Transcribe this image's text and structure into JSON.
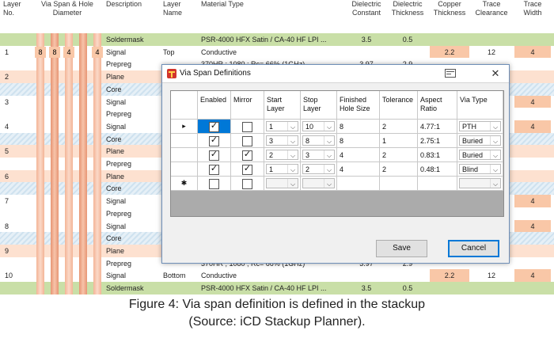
{
  "stackup": {
    "columns": [
      "Layer No.",
      "Via Span & Hole Diameter",
      "Description",
      "Layer Name",
      "Material Type",
      "Dielectric Constant",
      "Dielectric Thickness",
      "Copper Thickness",
      "Trace Clearance",
      "Trace Width"
    ],
    "via_header_values": [
      "8",
      "8",
      "4",
      "4"
    ],
    "rows": [
      {
        "no": "",
        "desc": "Soldermask",
        "name": "",
        "material": "PSR-4000 HFX Satin / CA-40 HF LPI ...",
        "dk": "3.5",
        "dt": "0.5",
        "cu": "",
        "clr": "",
        "w": "",
        "bg": "green"
      },
      {
        "no": "1",
        "desc": "Signal",
        "name": "Top",
        "material": "Conductive",
        "dk": "",
        "dt": "",
        "cu": "2.2",
        "clr": "12",
        "w": "4",
        "bg": "white"
      },
      {
        "no": "",
        "desc": "Prepreg",
        "name": "",
        "material": "370HR ; 1080 ; Rc= 66% (1GHz)",
        "dk": "3.97",
        "dt": "2.9",
        "cu": "",
        "clr": "",
        "w": "",
        "bg": "white"
      },
      {
        "no": "2",
        "desc": "Plane",
        "name": "",
        "material": "",
        "dk": "",
        "dt": "",
        "cu": "",
        "clr": "",
        "w": "",
        "bg": "peach"
      },
      {
        "no": "",
        "desc": "Core",
        "name": "",
        "material": "",
        "dk": "",
        "dt": "",
        "cu": "",
        "clr": "",
        "w": "",
        "bg": "hatch"
      },
      {
        "no": "3",
        "desc": "Signal",
        "name": "",
        "material": "",
        "dk": "",
        "dt": "",
        "cu": "",
        "clr": "",
        "w": "4",
        "bg": "white"
      },
      {
        "no": "",
        "desc": "Prepreg",
        "name": "",
        "material": "",
        "dk": "",
        "dt": "",
        "cu": "",
        "clr": "",
        "w": "",
        "bg": "white"
      },
      {
        "no": "4",
        "desc": "Signal",
        "name": "",
        "material": "",
        "dk": "",
        "dt": "",
        "cu": "",
        "clr": "",
        "w": "4",
        "bg": "white"
      },
      {
        "no": "",
        "desc": "Core",
        "name": "",
        "material": "",
        "dk": "",
        "dt": "",
        "cu": "",
        "clr": "",
        "w": "",
        "bg": "hatch"
      },
      {
        "no": "5",
        "desc": "Plane",
        "name": "",
        "material": "",
        "dk": "",
        "dt": "",
        "cu": "",
        "clr": "",
        "w": "",
        "bg": "peach"
      },
      {
        "no": "",
        "desc": "Prepreg",
        "name": "",
        "material": "",
        "dk": "",
        "dt": "",
        "cu": "",
        "clr": "",
        "w": "",
        "bg": "white"
      },
      {
        "no": "6",
        "desc": "Plane",
        "name": "",
        "material": "",
        "dk": "",
        "dt": "",
        "cu": "",
        "clr": "",
        "w": "",
        "bg": "peach"
      },
      {
        "no": "",
        "desc": "Core",
        "name": "",
        "material": "",
        "dk": "",
        "dt": "",
        "cu": "",
        "clr": "",
        "w": "",
        "bg": "hatch"
      },
      {
        "no": "7",
        "desc": "Signal",
        "name": "",
        "material": "",
        "dk": "",
        "dt": "",
        "cu": "",
        "clr": "",
        "w": "4",
        "bg": "white"
      },
      {
        "no": "",
        "desc": "Prepreg",
        "name": "",
        "material": "",
        "dk": "",
        "dt": "",
        "cu": "",
        "clr": "",
        "w": "",
        "bg": "white"
      },
      {
        "no": "8",
        "desc": "Signal",
        "name": "",
        "material": "",
        "dk": "",
        "dt": "",
        "cu": "",
        "clr": "",
        "w": "4",
        "bg": "white"
      },
      {
        "no": "",
        "desc": "Core",
        "name": "",
        "material": "",
        "dk": "",
        "dt": "",
        "cu": "",
        "clr": "",
        "w": "",
        "bg": "hatch"
      },
      {
        "no": "9",
        "desc": "Plane",
        "name": "",
        "material": "",
        "dk": "",
        "dt": "",
        "cu": "",
        "clr": "",
        "w": "",
        "bg": "peach"
      },
      {
        "no": "",
        "desc": "Prepreg",
        "name": "",
        "material": "370HR ; 1080 ; Rc= 66% (1GHz)",
        "dk": "3.97",
        "dt": "2.9",
        "cu": "",
        "clr": "",
        "w": "",
        "bg": "white"
      },
      {
        "no": "10",
        "desc": "Signal",
        "name": "Bottom",
        "material": "Conductive",
        "dk": "",
        "dt": "",
        "cu": "2.2",
        "clr": "12",
        "w": "4",
        "bg": "white"
      },
      {
        "no": "",
        "desc": "Soldermask",
        "name": "",
        "material": "PSR-4000 HFX Satin / CA-40 HF LPI ...",
        "dk": "3.5",
        "dt": "0.5",
        "cu": "",
        "clr": "",
        "w": "",
        "bg": "green"
      }
    ]
  },
  "dialog": {
    "title": "Via Span Definitions",
    "close_glyph": "✕",
    "columns": [
      "",
      "Enabled",
      "Mirror",
      "Start Layer",
      "Stop Layer",
      "Finished Hole Size",
      "Tolerance",
      "Aspect Ratio",
      "Via Type"
    ],
    "rows": [
      {
        "indicator": "▸",
        "enabled": true,
        "mirror": false,
        "start": "1",
        "stop": "10",
        "hole": "8",
        "tol": "2",
        "aspect": "4.77:1",
        "type": "PTH",
        "selected": true
      },
      {
        "indicator": "",
        "enabled": true,
        "mirror": false,
        "start": "3",
        "stop": "8",
        "hole": "8",
        "tol": "1",
        "aspect": "2.75:1",
        "type": "Buried",
        "selected": false
      },
      {
        "indicator": "",
        "enabled": true,
        "mirror": true,
        "start": "2",
        "stop": "3",
        "hole": "4",
        "tol": "2",
        "aspect": "0.83:1",
        "type": "Buried",
        "selected": false
      },
      {
        "indicator": "",
        "enabled": true,
        "mirror": true,
        "start": "1",
        "stop": "2",
        "hole": "4",
        "tol": "2",
        "aspect": "0.48:1",
        "type": "Blind",
        "selected": false
      },
      {
        "indicator": "✱",
        "enabled": false,
        "mirror": false,
        "start": "",
        "stop": "",
        "hole": "",
        "tol": "",
        "aspect": "",
        "type": "",
        "selected": false
      }
    ],
    "save_label": "Save",
    "cancel_label": "Cancel"
  },
  "caption": {
    "line1": "Figure 4: Via span definition is defined in the stackup",
    "line2": "(Source: iCD Stackup Planner)."
  },
  "colors": {
    "soldermask": "#c9dfa7",
    "plane": "#fde1d0",
    "via_bar": "#f3b496",
    "dialog_accent": "#0078d7",
    "selection": "#0078d7"
  }
}
